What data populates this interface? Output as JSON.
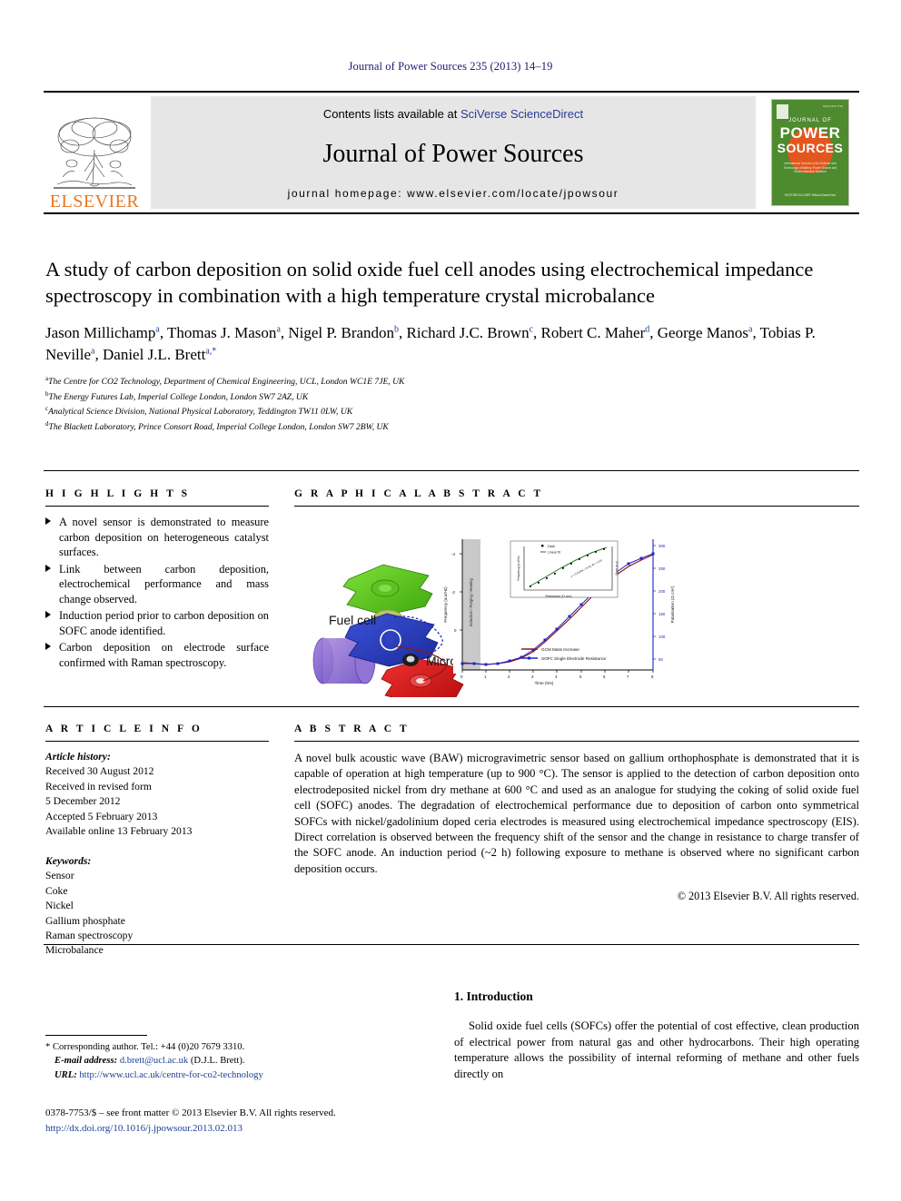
{
  "running_head": "Journal of Power Sources 235 (2013) 14–19",
  "masthead": {
    "contents_prefix": "Contents lists available at ",
    "sciencedirect": "SciVerse ScienceDirect",
    "journal_name": "Journal of Power Sources",
    "homepage": "journal homepage: www.elsevier.com/locate/jpowsour",
    "publisher_wordmark": "ELSEVIER",
    "cover": {
      "journal_of": "JOURNAL OF",
      "power": "POWER",
      "sources": "SOURCES",
      "issn": "ISSN 0378-7753",
      "subtitle": "International Journal on the Science and Technology of Battery, Power Source and Electrochemical Systems",
      "editors": "EDITORS-IN-CHIEF\nWilson-Davis/Yard"
    },
    "accent_orange": "#e87722",
    "cover_green": "#4e8a2e",
    "link_blue": "#2b3a96"
  },
  "article": {
    "title": "A study of carbon deposition on solid oxide fuel cell anodes using electrochemical impedance spectroscopy in combination with a high temperature crystal microbalance",
    "authors_line_1": "Jason Millichamp",
    "authors": [
      {
        "name": "Jason Millichamp",
        "sup": "a",
        "sep": ", "
      },
      {
        "name": "Thomas J. Mason",
        "sup": "a",
        "sep": ", "
      },
      {
        "name": "Nigel P. Brandon",
        "sup": "b",
        "sep": ", "
      },
      {
        "name": "Richard J.C. Brown",
        "sup": "c",
        "sep": ", "
      },
      {
        "name": "Robert C. Maher",
        "sup": "d",
        "sep": ", "
      },
      {
        "name": "George Manos",
        "sup": "a",
        "sep": ", "
      },
      {
        "name": "Tobias P. Neville",
        "sup": "a",
        "sep": ", "
      },
      {
        "name": "Daniel J.L. Brett",
        "sup": "a,*",
        "sep": ""
      }
    ],
    "affiliations": [
      {
        "sup": "a",
        "text": "The Centre for CO2 Technology, Department of Chemical Engineering, UCL, London WC1E 7JE, UK"
      },
      {
        "sup": "b",
        "text": "The Energy Futures Lab, Imperial College London, London SW7 2AZ, UK"
      },
      {
        "sup": "c",
        "text": "Analytical Science Division, National Physical Laboratory, Teddington TW11 0LW, UK"
      },
      {
        "sup": "d",
        "text": "The Blackett Laboratory, Prince Consort Road, Imperial College London, London SW7 2BW, UK"
      }
    ]
  },
  "highlights": {
    "heading": "H I G H L I G H T S",
    "items": [
      "A novel sensor is demonstrated to measure carbon deposition on heterogeneous catalyst surfaces.",
      "Link between carbon deposition, electrochemical performance and mass change observed.",
      "Induction period prior to carbon deposition on SOFC anode identified.",
      "Carbon deposition on electrode surface confirmed with Raman spectroscopy."
    ]
  },
  "graphical_abstract": {
    "heading": "G R A P H I C A L   A B S T R A C T",
    "labels": {
      "fuel_cell": "Fuel cell",
      "microbalance": "Microbalance"
    },
    "chart_data": {
      "type": "line",
      "title": "",
      "xlabel": "Time (hrs)",
      "ylabel_left": "Frequency (a.u/Hz)",
      "ylabel_right": "Polarisation (Ω cm²)",
      "xlim": [
        0,
        8
      ],
      "xticks": [
        0,
        1,
        2,
        3,
        4,
        5,
        6,
        7,
        8
      ],
      "left_ticks": [
        "-4",
        "-2",
        "0"
      ],
      "right_ticks": [
        "50",
        "100",
        "150",
        "200",
        "250",
        "300"
      ],
      "shaded_band_label": "Induction / Purging / Heating",
      "shaded_band_x": [
        0,
        0.85
      ],
      "legend_position": "bottom-center",
      "series": [
        {
          "name": "GCM Mass Increase",
          "color": "#8b1a1a",
          "marker": "none",
          "x": [
            0,
            0.5,
            1,
            1.5,
            2,
            2.5,
            3,
            3.5,
            4,
            4.5,
            5,
            5.5,
            6,
            6.5,
            7,
            7.5,
            8
          ],
          "y": [
            18,
            17,
            16,
            17,
            20,
            26,
            38,
            57,
            80,
            105,
            130,
            155,
            180,
            200,
            218,
            232,
            243
          ]
        },
        {
          "name": "SOFC Single Electrode Resistance",
          "color": "#2222cc",
          "marker": "square",
          "x": [
            0,
            0.5,
            1,
            1.5,
            2,
            2.5,
            3,
            3.5,
            4,
            4.5,
            5,
            5.5,
            6,
            6.5,
            7,
            7.5,
            8
          ],
          "y": [
            16,
            16,
            15,
            17,
            21,
            28,
            41,
            60,
            84,
            110,
            136,
            160,
            186,
            205,
            222,
            234,
            245
          ]
        }
      ],
      "inset": {
        "type": "scatter",
        "xlabel": "Resistance (Ω cm²)",
        "ylabel_left": "Frequency (a.u/Hz)",
        "ylabel_right": "Mass (a.u)",
        "xticks": [
          0,
          40,
          80,
          120,
          160,
          200
        ],
        "legend": [
          "Data",
          "Linear fit"
        ],
        "fit_color": "#1e7a1e",
        "data_color": "#000000",
        "annotation": "y = 0.0183x + 0.44, R² = 0.97"
      }
    }
  },
  "article_info": {
    "heading": "A R T I C L E   I N F O",
    "history_label": "Article history:",
    "history": [
      "Received 30 August 2012",
      "Received in revised form",
      "5 December 2012",
      "Accepted 5 February 2013",
      "Available online 13 February 2013"
    ],
    "keywords_label": "Keywords:",
    "keywords": [
      "Sensor",
      "Coke",
      "Nickel",
      "Gallium phosphate",
      "Raman spectroscopy",
      "Microbalance"
    ]
  },
  "abstract": {
    "heading": "A B S T R A C T",
    "text": "A novel bulk acoustic wave (BAW) microgravimetric sensor based on gallium orthophosphate is demonstrated that it is capable of operation at high temperature (up to 900 °C). The sensor is applied to the detection of carbon deposition onto electrodeposited nickel from dry methane at 600 °C and used as an analogue for studying the coking of solid oxide fuel cell (SOFC) anodes. The degradation of electrochemical performance due to deposition of carbon onto symmetrical SOFCs with nickel/gadolinium doped ceria electrodes is measured using electrochemical impedance spectroscopy (EIS). Direct correlation is observed between the frequency shift of the sensor and the change in resistance to charge transfer of the SOFC anode. An induction period (~2 h) following exposure to methane is observed where no significant carbon deposition occurs.",
    "copyright": "© 2013 Elsevier B.V. All rights reserved."
  },
  "footer": {
    "corresponding": "* Corresponding author. Tel.: +44 (0)20 7679 3310.",
    "email_label": "E-mail address:",
    "email": "d.brett@ucl.ac.uk",
    "email_suffix": "(D.J.L. Brett).",
    "url_label": "URL:",
    "url": "http://www.ucl.ac.uk/centre-for-co2-technology",
    "front_matter": "0378-7753/$ – see front matter © 2013 Elsevier B.V. All rights reserved.",
    "doi": "http://dx.doi.org/10.1016/j.jpowsour.2013.02.013"
  },
  "introduction": {
    "heading": "1. Introduction",
    "paragraph": "Solid oxide fuel cells (SOFCs) offer the potential of cost effective, clean production of electrical power from natural gas and other hydrocarbons. Their high operating temperature allows the possibility of internal reforming of methane and other fuels directly on"
  }
}
